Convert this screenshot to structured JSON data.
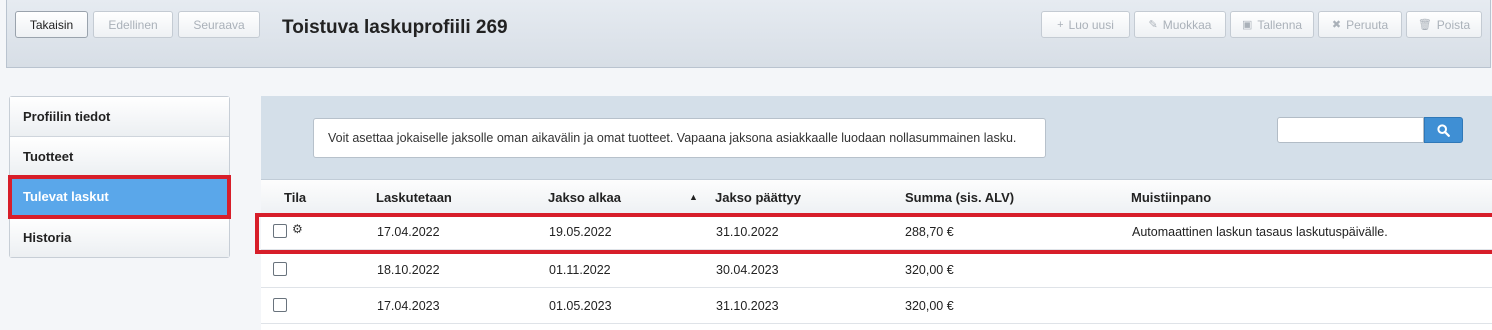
{
  "toolbar": {
    "back": "Takaisin",
    "previous": "Edellinen",
    "next": "Seuraava",
    "title": "Toistuva laskuprofiili 269",
    "create": "Luo uusi",
    "edit": "Muokkaa",
    "save": "Tallenna",
    "cancel": "Peruuta",
    "delete": "Poista"
  },
  "sidebar": {
    "items": [
      {
        "label": "Profiilin tiedot",
        "active": false
      },
      {
        "label": "Tuotteet",
        "active": false
      },
      {
        "label": "Tulevat laskut",
        "active": true
      },
      {
        "label": "Historia",
        "active": false
      }
    ]
  },
  "info": "Voit asettaa jokaiselle jaksolle oman aikavälin ja omat tuotteet. Vapaana jaksona asiakkaalle luodaan nollasummainen lasku.",
  "search": {
    "placeholder": ""
  },
  "table": {
    "columns": [
      "Tila",
      "Laskutetaan",
      "Jakso alkaa",
      "Jakso päättyy",
      "Summa (sis. ALV)",
      "Muistiinpano"
    ],
    "sorted_column": "Jakso alkaa",
    "rows": [
      {
        "billed": "17.04.2022",
        "start": "19.05.2022",
        "end": "31.10.2022",
        "sum": "288,70 €",
        "note": "Automaattinen laskun tasaus laskutuspäivälle."
      },
      {
        "billed": "18.10.2022",
        "start": "01.11.2022",
        "end": "30.04.2023",
        "sum": "320,00 €",
        "note": ""
      },
      {
        "billed": "17.04.2023",
        "start": "01.05.2023",
        "end": "31.10.2023",
        "sum": "320,00 €",
        "note": ""
      }
    ]
  },
  "colors": {
    "accent": "#5aa7ea",
    "highlight": "#d71e2a",
    "search_button": "#3f8fd4"
  }
}
